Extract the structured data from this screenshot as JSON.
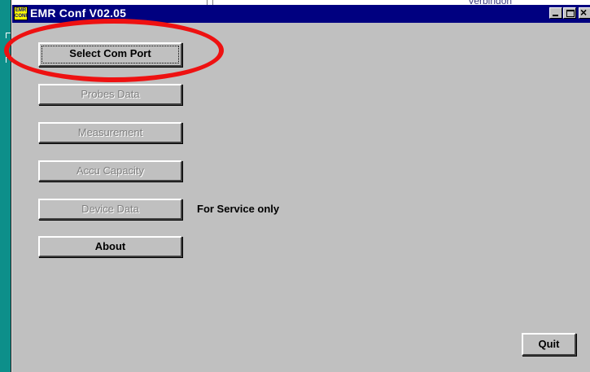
{
  "background": {
    "text": "Verbindon"
  },
  "window": {
    "icon_text": "EMR CONF",
    "title": "EMR Conf V02.05"
  },
  "buttons": {
    "select_com_port": "Select Com Port",
    "probes_data": "Probes Data",
    "measurement": "Measurement",
    "accu_capacity": "Accu Capacity",
    "device_data": "Device Data",
    "about": "About",
    "quit": "Quit"
  },
  "notes": {
    "service_only": "For Service only"
  },
  "colors": {
    "titlebar": "#000080",
    "face": "#c0c0c0",
    "highlight": "#ee1111",
    "disabled_text": "#808080"
  }
}
